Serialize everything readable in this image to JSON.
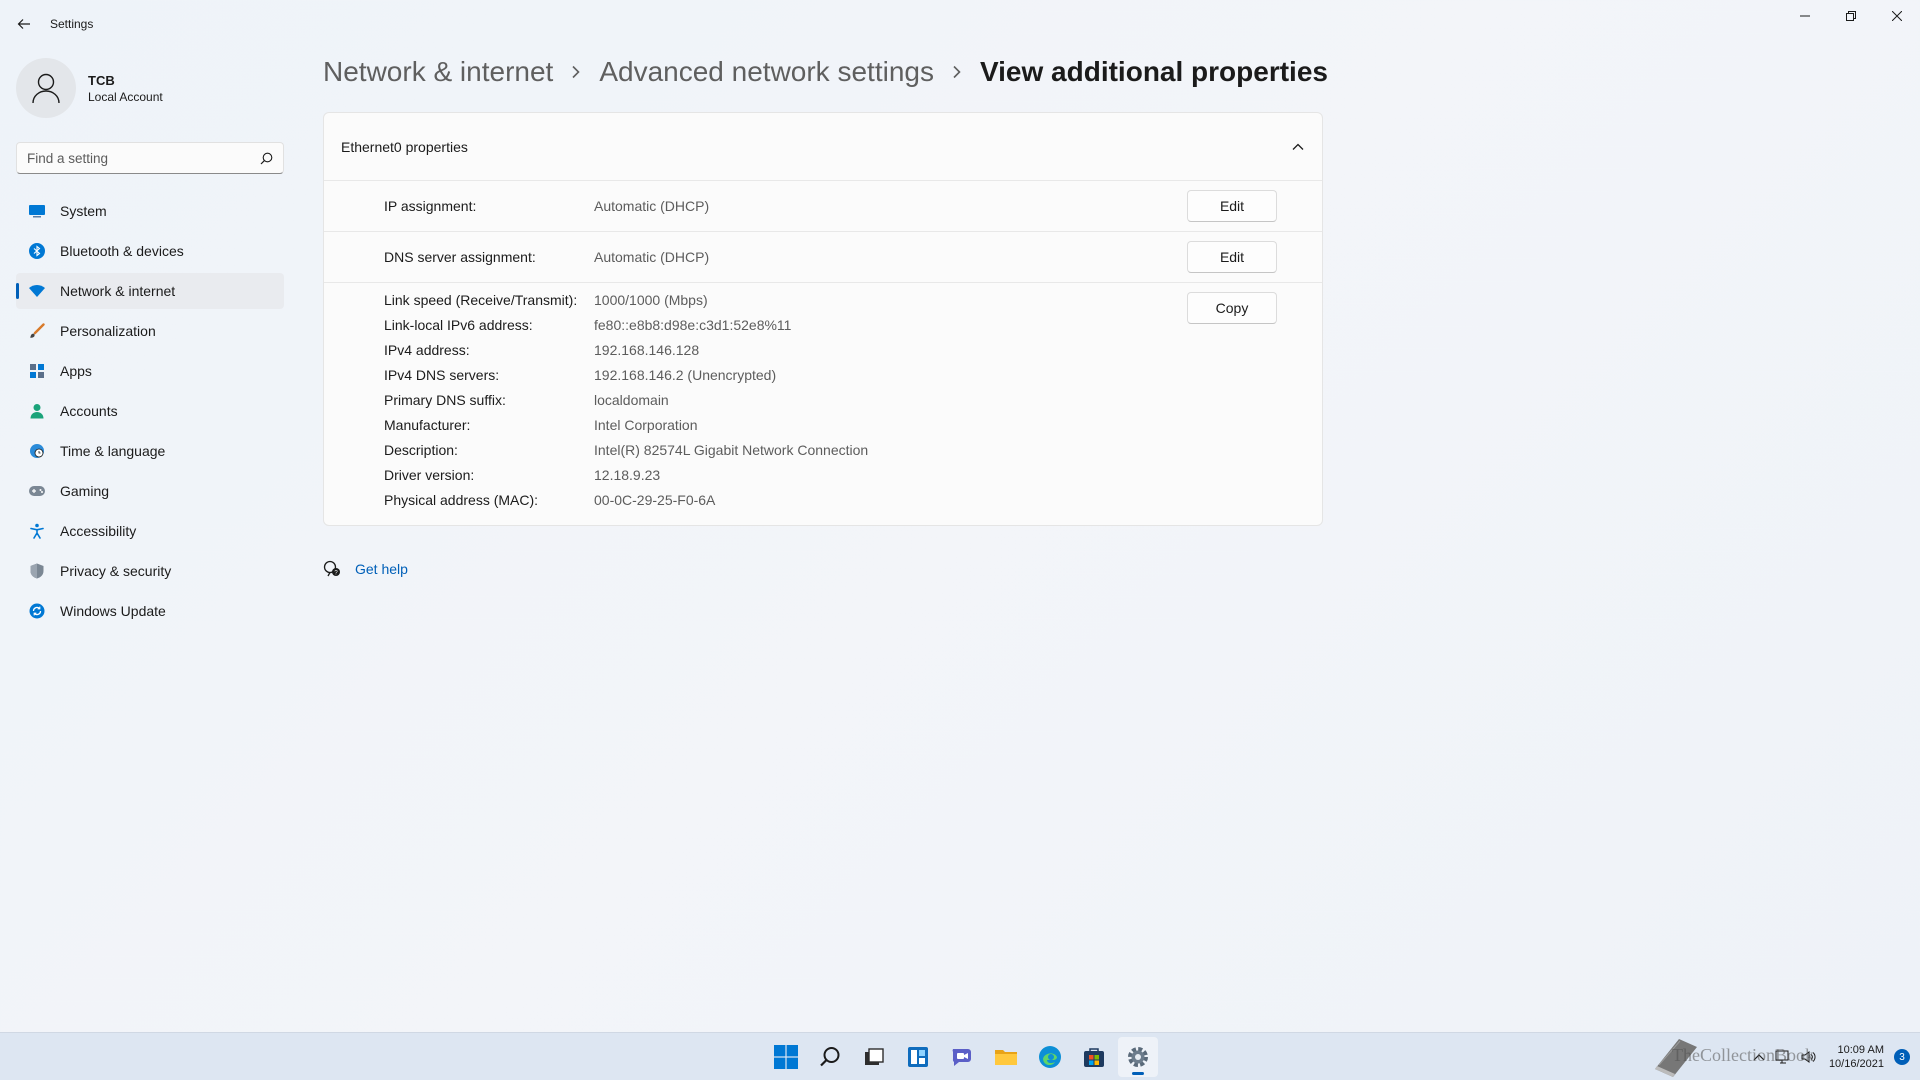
{
  "window": {
    "title": "Settings"
  },
  "profile": {
    "name": "TCB",
    "account_type": "Local Account"
  },
  "search": {
    "placeholder": "Find a setting"
  },
  "sidebar": {
    "items": [
      {
        "label": "System",
        "icon": "monitor-icon"
      },
      {
        "label": "Bluetooth & devices",
        "icon": "bluetooth-icon"
      },
      {
        "label": "Network & internet",
        "icon": "wifi-icon",
        "active": true
      },
      {
        "label": "Personalization",
        "icon": "brush-icon"
      },
      {
        "label": "Apps",
        "icon": "apps-icon"
      },
      {
        "label": "Accounts",
        "icon": "person-icon"
      },
      {
        "label": "Time & language",
        "icon": "globe-clock-icon"
      },
      {
        "label": "Gaming",
        "icon": "gamepad-icon"
      },
      {
        "label": "Accessibility",
        "icon": "accessibility-icon"
      },
      {
        "label": "Privacy & security",
        "icon": "shield-icon"
      },
      {
        "label": "Windows Update",
        "icon": "update-icon"
      }
    ]
  },
  "breadcrumb": {
    "level1": "Network & internet",
    "level2": "Advanced network settings",
    "current": "View additional properties"
  },
  "card": {
    "title": "Ethernet0 properties",
    "ip_assignment": {
      "label": "IP assignment:",
      "value": "Automatic (DHCP)",
      "button": "Edit"
    },
    "dns_assignment": {
      "label": "DNS server assignment:",
      "value": "Automatic (DHCP)",
      "button": "Edit"
    },
    "copy_button": "Copy",
    "details": [
      {
        "label": "Link speed (Receive/Transmit):",
        "value": "1000/1000 (Mbps)"
      },
      {
        "label": "Link-local IPv6 address:",
        "value": "fe80::e8b8:d98e:c3d1:52e8%11"
      },
      {
        "label": "IPv4 address:",
        "value": "192.168.146.128"
      },
      {
        "label": "IPv4 DNS servers:",
        "value": "192.168.146.2 (Unencrypted)"
      },
      {
        "label": "Primary DNS suffix:",
        "value": "localdomain"
      },
      {
        "label": "Manufacturer:",
        "value": "Intel Corporation"
      },
      {
        "label": "Description:",
        "value": "Intel(R) 82574L Gigabit Network Connection"
      },
      {
        "label": "Driver version:",
        "value": "12.18.9.23"
      },
      {
        "label": "Physical address (MAC):",
        "value": "00-0C-29-25-F0-6A"
      }
    ]
  },
  "help": {
    "label": "Get help"
  },
  "taskbar": {
    "watermark": "TheCollectionBook",
    "time": "10:09 AM",
    "date": "10/16/2021",
    "notification_count": "3"
  },
  "colors": {
    "accent": "#005fb8"
  }
}
